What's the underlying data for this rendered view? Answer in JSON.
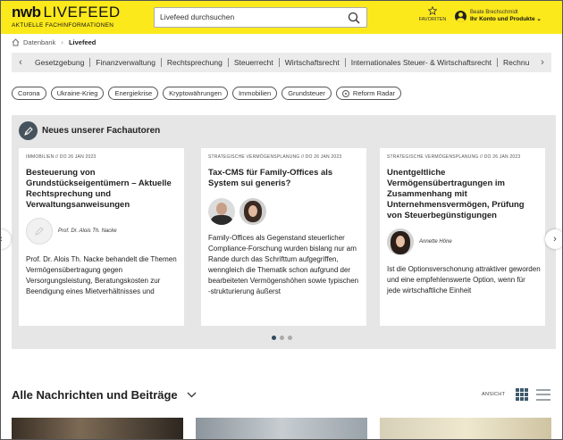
{
  "header": {
    "logo_brand": "nwb",
    "logo_product": "LIVEFEED",
    "logo_tagline": "AKTUELLE FACHINFORMATIONEN",
    "search_placeholder": "Livefeed durchsuchen",
    "favorites_label": "FAVORITEN",
    "account_name": "Beate Brechschmidt",
    "account_menu": "Ihr Konto und Produkte ⌄"
  },
  "breadcrumb": {
    "root": "Datenbank",
    "current": "Livefeed"
  },
  "category_nav": {
    "items": [
      "Gesetzgebung",
      "Finanzverwaltung",
      "Rechtsprechung",
      "Steuerrecht",
      "Wirtschaftsrecht",
      "Internationales Steuer- & Wirtschaftsrecht",
      "Rechnu"
    ]
  },
  "tags": [
    "Corona",
    "Ukraine-Krieg",
    "Energiekrise",
    "Kryptowährungen",
    "Immobilien",
    "Grundsteuer",
    "Reform Radar"
  ],
  "featured": {
    "title": "Neues unserer Fachautoren",
    "cards": [
      {
        "meta": "IMMOBILIEN //  DO 26 JAN 2023",
        "title": "Besteuerung von Grundstückseigentümern – Aktuelle Rechtsprechung und Verwaltungsanweisungen",
        "author": "Prof. Dr. Alois Th. Nacke",
        "teaser": "Prof. Dr. Alois Th. Nacke behandelt die Themen Vermögensübertragung gegen Versorgungsleistung, Beratungskosten zur Beendigung eines Mietverhältnisses und"
      },
      {
        "meta": "STRATEGISCHE VERMÖGENSPLANUNG //  DO 26 JAN 2023",
        "title": "Tax-CMS für Family-Offices als System sui generis?",
        "author": "",
        "teaser": "Family-Offices als Gegenstand steuerlicher Compliance-Forschung wurden bislang nur am Rande durch das Schrifttum aufgegriffen, wenngleich die Thematik schon aufgrund der bearbeiteten Vermögenshöhen sowie typischen -strukturierung äußerst"
      },
      {
        "meta": "STRATEGISCHE VERMÖGENSPLANUNG //  DO 26 JAN 2023",
        "title": "Unentgeltliche Vermögensübertragungen im Zusammenhang mit Unternehmensvermögen, Prüfung von Steuerbegünstigungen",
        "author": "Annette Höne",
        "teaser": "Ist die Optionsverschonung attraktiver geworden und eine empfehlenswerte Option, wenn für jede wirtschaftliche Einheit"
      }
    ]
  },
  "news": {
    "title": "Alle Nachrichten und Beiträge",
    "view_label": "ANSICHT"
  }
}
